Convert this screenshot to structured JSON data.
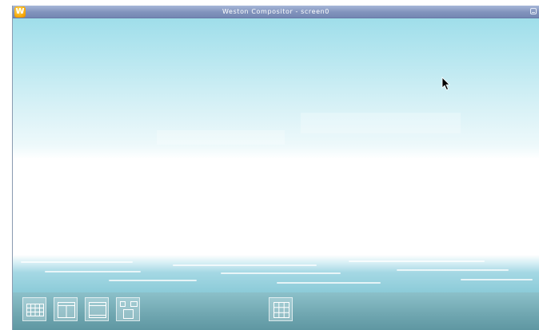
{
  "window": {
    "title": "Weston Compositor - screen0",
    "app_icon_letter": "W"
  },
  "panel": {
    "launchers": [
      {
        "name": "launcher-grid-icon"
      },
      {
        "name": "launcher-split-view-icon"
      },
      {
        "name": "launcher-window-icon"
      },
      {
        "name": "launcher-layout-icon"
      },
      {
        "name": "launcher-apps-grid-icon"
      }
    ]
  },
  "colors": {
    "titlebar": "#7f91bb",
    "sky_top": "#9fdeea",
    "water": "#8ccbd8",
    "panel": "#6fa6b0"
  }
}
